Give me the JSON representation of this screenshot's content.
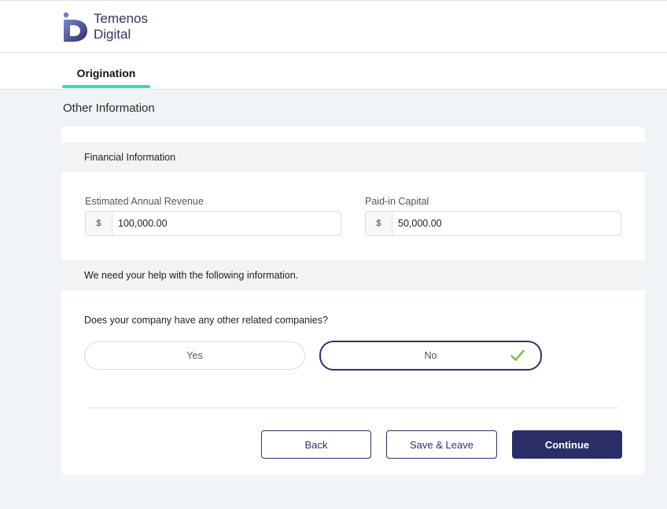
{
  "header": {
    "brand_line1": "Temenos",
    "brand_line2": "Digital",
    "logo_icon": "temenos-d-logo"
  },
  "tabs": [
    {
      "label": "Origination",
      "active": true
    }
  ],
  "page": {
    "section_title": "Other Information"
  },
  "financial": {
    "band_title": "Financial Information",
    "revenue_label": "Estimated Annual Revenue",
    "revenue_currency": "$",
    "revenue_value": "100,000.00",
    "capital_label": "Paid-in Capital",
    "capital_currency": "$",
    "capital_value": "50,000.00"
  },
  "help": {
    "band_title": "We need your help with the following information.",
    "question": "Does your company have any other related companies?",
    "options": [
      {
        "label": "Yes",
        "selected": false
      },
      {
        "label": "No",
        "selected": true
      }
    ],
    "selected_icon": "checkmark-icon"
  },
  "actions": {
    "back_label": "Back",
    "save_label": "Save & Leave",
    "continue_label": "Continue"
  },
  "colors": {
    "accent_navy": "#2a2d66",
    "tab_underline": "#3dd9b6",
    "check_green": "#7ac143",
    "page_background": "#f1f4f7"
  }
}
